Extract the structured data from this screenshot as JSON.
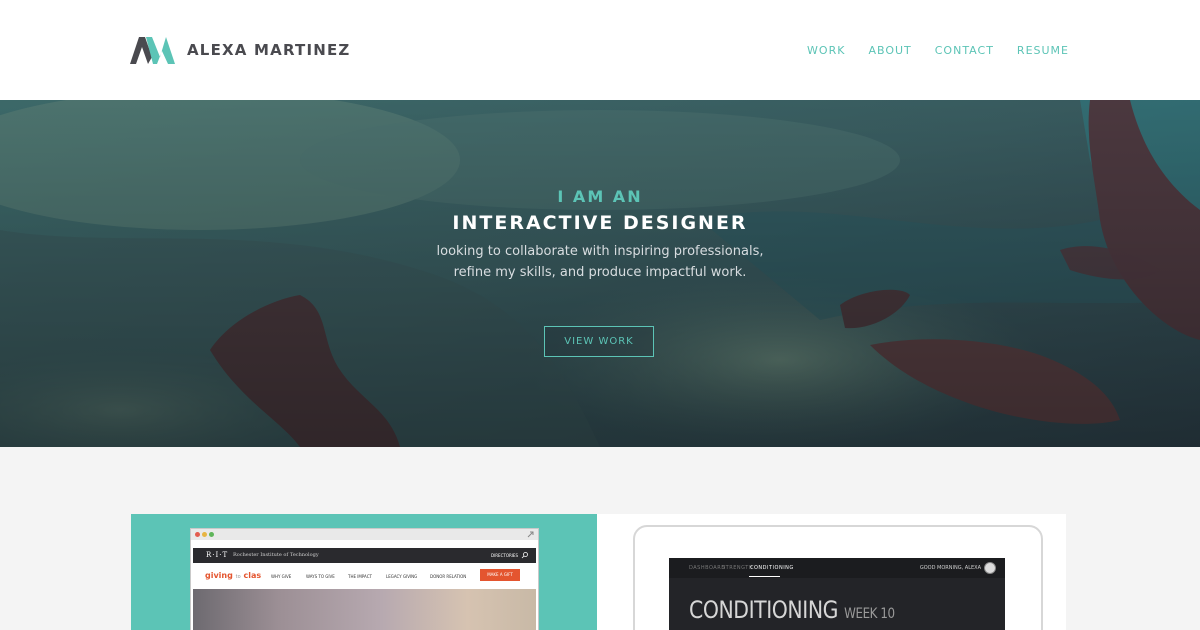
{
  "header": {
    "brand": "ALEXA MARTINEZ",
    "nav": [
      "WORK",
      "ABOUT",
      "CONTACT",
      "RESUME"
    ]
  },
  "hero": {
    "kicker": "I AM AN",
    "headline": "INTERACTIVE DESIGNER",
    "sub_line1": "looking to collaborate with inspiring professionals,",
    "sub_line2": "refine my skills, and produce impactful work.",
    "cta": "VIEW WORK"
  },
  "project1": {
    "logo": "R·I·T",
    "institution": "Rochester Institute of Technology",
    "directories": "DIRECTORIES",
    "site_logo_main": "giving",
    "site_logo_to": "to",
    "site_logo_end": "clas",
    "nav": [
      "WHY GIVE",
      "WAYS TO GIVE",
      "THE IMPACT",
      "LEGACY GIVING",
      "DONOR RELATION"
    ],
    "gift_button": "MAKE A GIFT"
  },
  "project2": {
    "tabs": [
      "DASHBOARD",
      "STRENGTH",
      "CONDITIONING"
    ],
    "greeting": "GOOD MORNING, ALEXA",
    "title": "CONDITIONING",
    "week": "WEEK 10"
  },
  "colors": {
    "accent": "#5cc4b6",
    "brand_text": "#4a4a4f",
    "gift_orange": "#e4552f"
  }
}
